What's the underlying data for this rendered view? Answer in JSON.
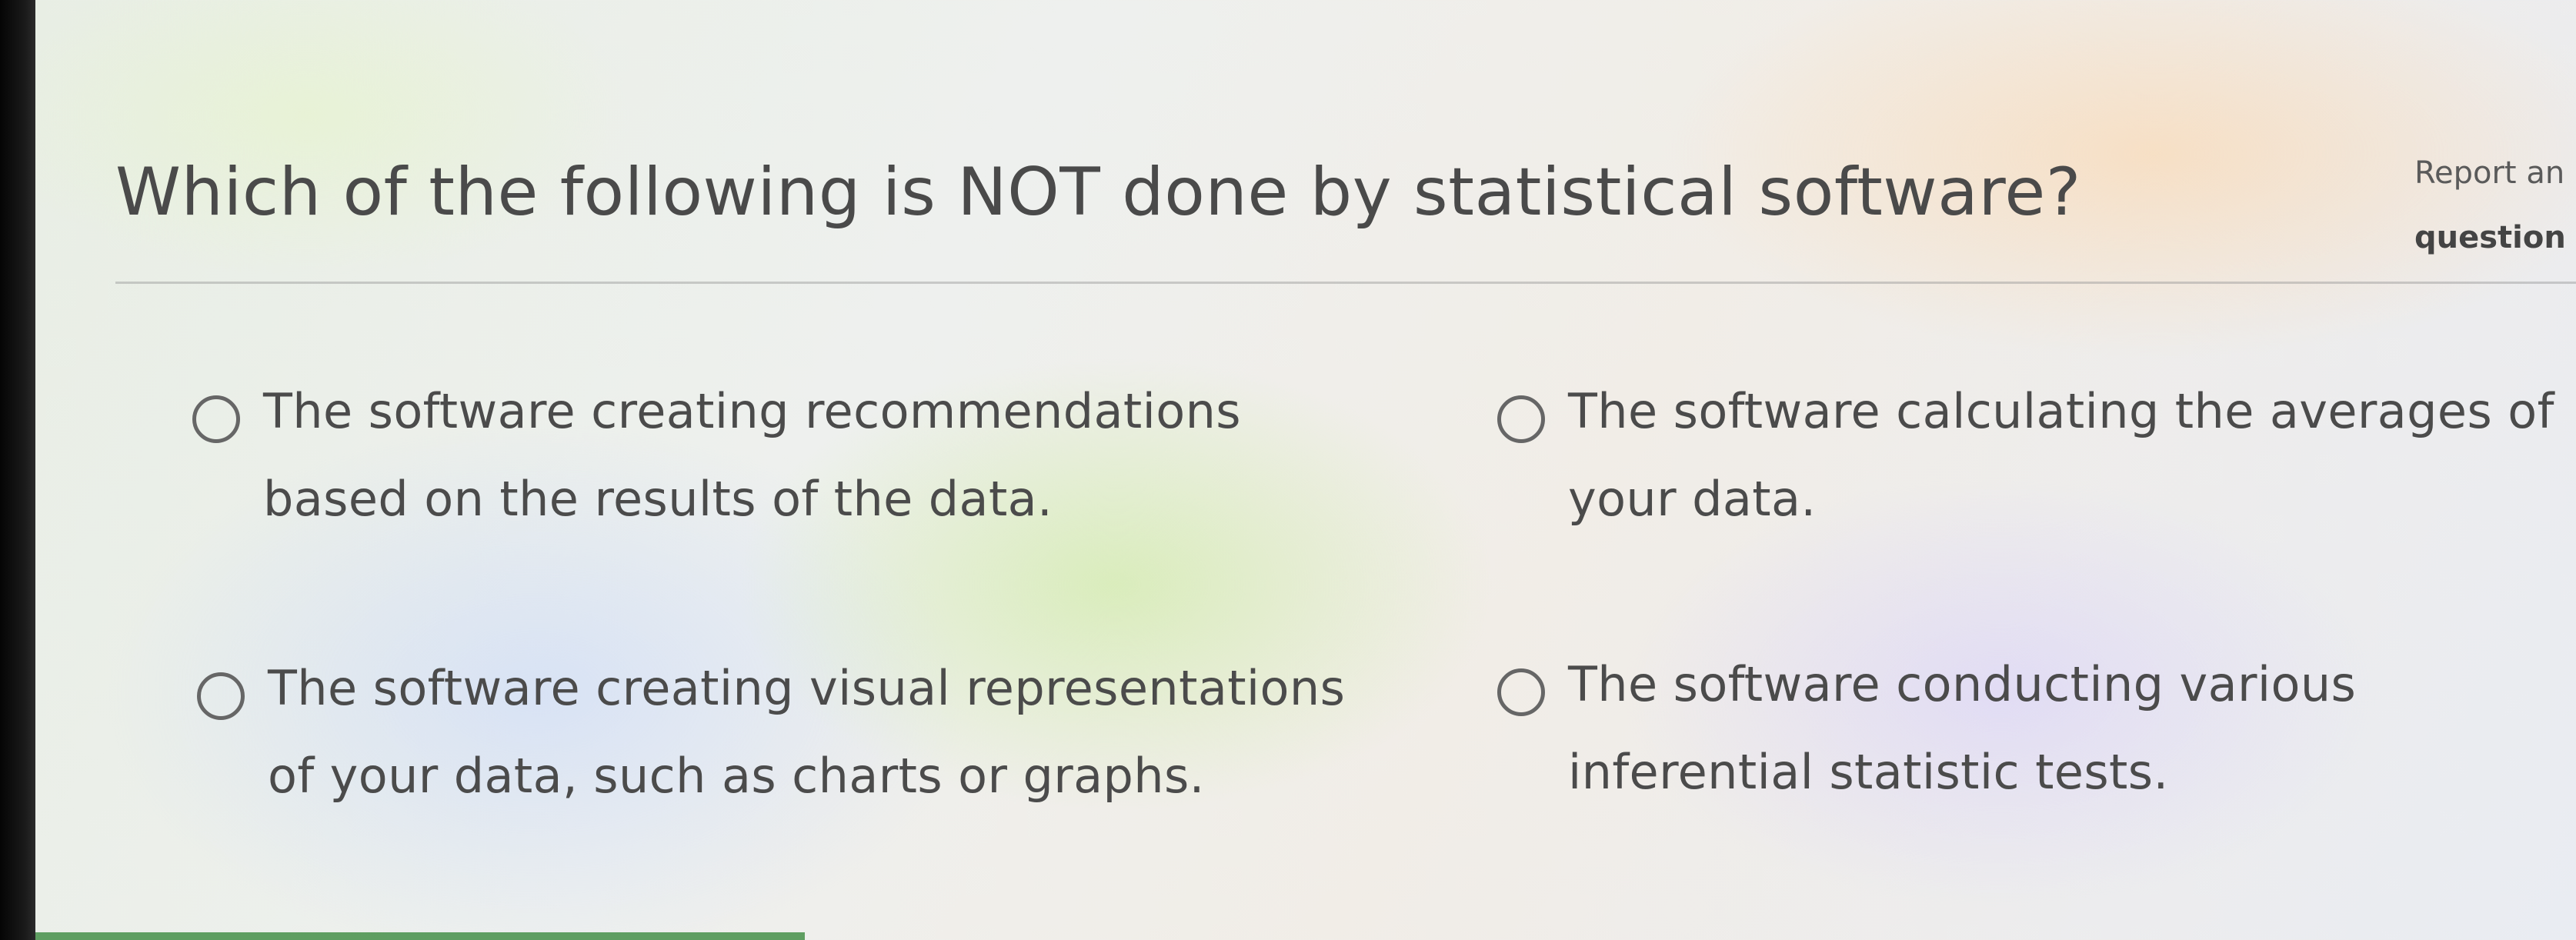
{
  "question": {
    "text": "Which of the following is NOT done by statistical software?"
  },
  "report": {
    "line1": "Report an",
    "line2": "question"
  },
  "options": [
    {
      "label": "The software creating recommendations based on the results of the data."
    },
    {
      "label": "The software calculating the averages of your data."
    },
    {
      "label": "The software creating visual representations of your data, such as charts or graphs."
    },
    {
      "label": "The software conducting various inferential statistic tests."
    }
  ],
  "colors": {
    "text": "#4b4b4b",
    "radio_border": "#666666",
    "accent_bottom": "#3b8a3e"
  }
}
